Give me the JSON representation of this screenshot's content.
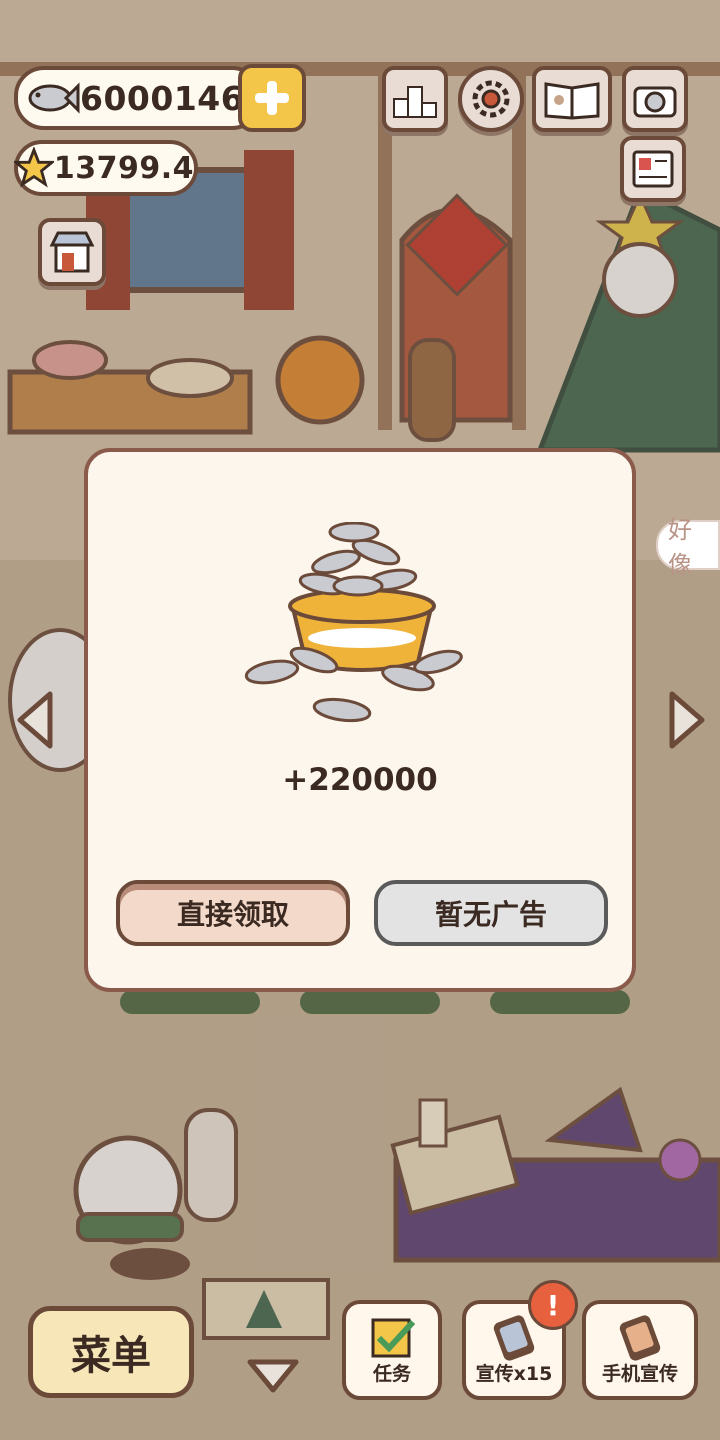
{
  "hud": {
    "fish_count": "6000146",
    "star_count": "13799.4",
    "ranking_icon": "ranking-podium-icon",
    "settings_icon": "gear-icon",
    "book_icon": "catbook-icon",
    "camera_icon": "camera-icon",
    "newspaper_icon": "newspaper-icon",
    "shop_icon": "shop-icon"
  },
  "dialog": {
    "reward_amount": "+220000",
    "claim_button": "直接领取",
    "no_ad_button": "暂无广告"
  },
  "bottom_bar": {
    "menu_label": "菜单",
    "tasks_label": "任务",
    "promote_label": "宣传x15",
    "phone_promote_label": "手机宣传",
    "alert_mark": "!"
  },
  "speech_bubble": {
    "text": "好像"
  },
  "colors": {
    "accent_yellow": "#f3c64a",
    "border_brown": "#6b4a3a",
    "dialog_bg": "#fdf6ec",
    "alert_red": "#e8613f"
  }
}
